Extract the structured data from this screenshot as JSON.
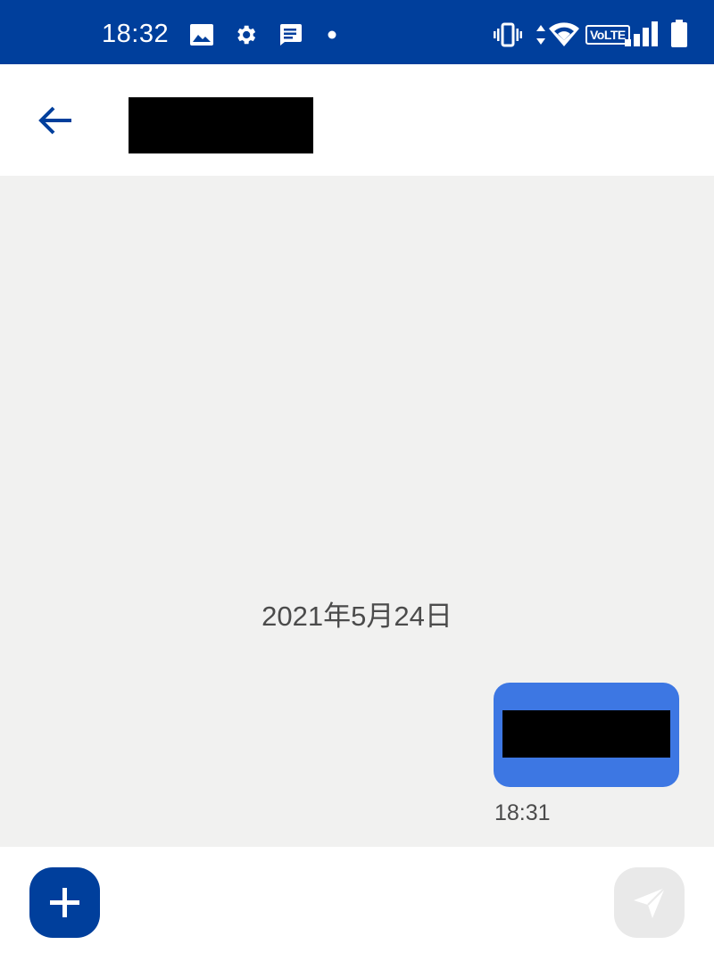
{
  "status_bar": {
    "time": "18:32",
    "left_icons": [
      "image-icon",
      "gear-icon",
      "message-notification-icon",
      "dot-icon"
    ],
    "right_icons": [
      "vibrate-icon",
      "data-arrows-icon",
      "wifi-icon",
      "volte-icon",
      "signal-icon",
      "battery-icon"
    ],
    "volte_label": "VoLTE",
    "background": "#003f9c"
  },
  "header": {
    "back_icon": "arrow-left-icon",
    "accent": "#003f9c"
  },
  "chat": {
    "date_label": "2021年5月24日",
    "messages": [
      {
        "direction": "outgoing",
        "time": "18:31",
        "bubble_color": "#3d77e3"
      }
    ],
    "background": "#f1f1f0"
  },
  "input_bar": {
    "add_icon": "plus-icon",
    "send_icon": "send-icon"
  }
}
